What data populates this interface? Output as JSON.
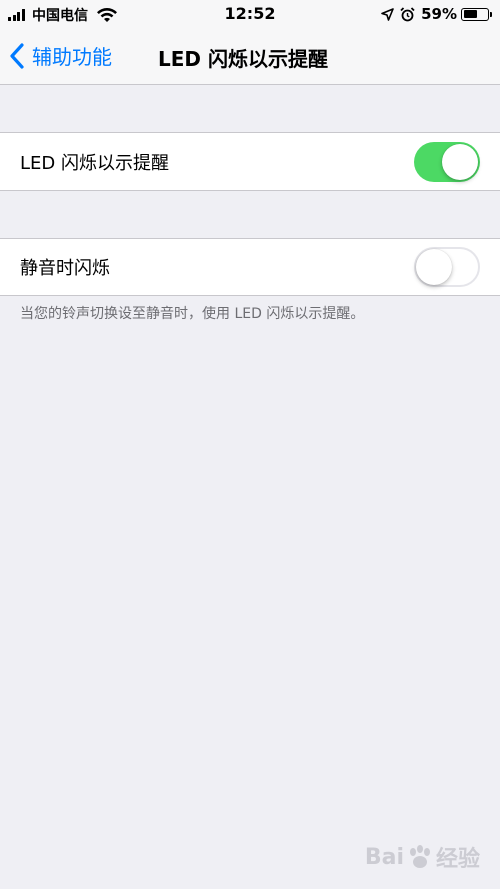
{
  "status_bar": {
    "carrier": "中国电信",
    "time": "12:52",
    "battery_percent": "59%",
    "battery_level": 0.59,
    "icons": [
      "signal-icon",
      "wifi-icon",
      "location-arrow-icon",
      "alarm-icon",
      "battery-icon"
    ]
  },
  "nav": {
    "back_label": "辅助功能",
    "title": "LED 闪烁以示提醒"
  },
  "settings": {
    "led_flash": {
      "label": "LED 闪烁以示提醒",
      "enabled": true
    },
    "flash_on_silent": {
      "label": "静音时闪烁",
      "enabled": false
    },
    "footer": "当您的铃声切换设至静音时，使用 LED 闪烁以示提醒。"
  },
  "watermark": {
    "text_left": "Bai",
    "text_right": "经验"
  },
  "colors": {
    "accent": "#007aff",
    "toggle_on": "#4cd964",
    "background": "#efeff4"
  }
}
